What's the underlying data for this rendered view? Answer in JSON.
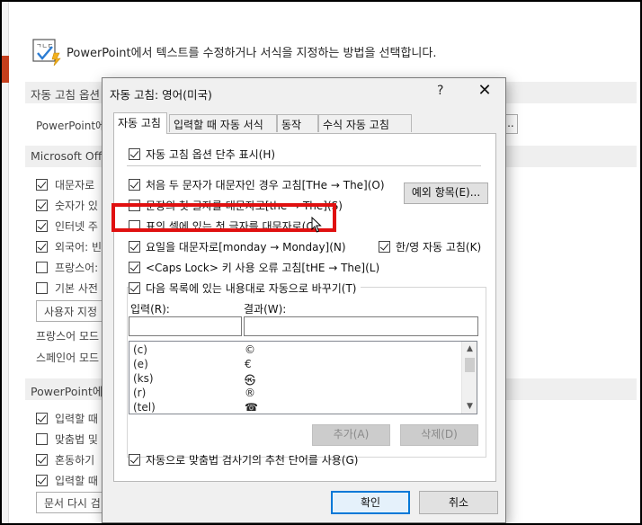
{
  "background": {
    "header_text": "PowerPoint에서 텍스트를 수정하거나 서식을 지정하는 방법을 선택합니다.",
    "header_icon": "abc-check-icon",
    "sections": [
      {
        "label": "자동 고침 옵션"
      },
      {
        "label": "Microsoft Office"
      },
      {
        "label": "PowerPoint에서"
      }
    ],
    "autocorrect_desc": "PowerPoint에",
    "office_options": [
      {
        "label": "대문자로",
        "checked": true
      },
      {
        "label": "숫자가 있",
        "checked": true
      },
      {
        "label": "인터넷 주",
        "checked": true
      },
      {
        "label": "외국어: 빈",
        "checked": true
      },
      {
        "label": "프랑스어:",
        "checked": false
      },
      {
        "label": "기본 사전",
        "checked": false
      }
    ],
    "custom_dict_button": "사용자 지정",
    "french_modes": "프랑스어 모드",
    "spanish_modes": "스페인어 모드",
    "ppt_options": [
      {
        "label": "입력할 때",
        "checked": true
      },
      {
        "label": "맞춤법 및",
        "checked": false
      },
      {
        "label": "혼동하기",
        "checked": true
      },
      {
        "label": "입력할 때",
        "checked": true
      }
    ],
    "recheck_button": "문서 다시 검",
    "dots_button": "..."
  },
  "dialog": {
    "title": "자동 고침: 영어(미국)",
    "help": "?",
    "close": "✕",
    "tabs": [
      {
        "label": "자동 고침",
        "active": true
      },
      {
        "label": "입력할 때 자동 서식",
        "active": false
      },
      {
        "label": "동작",
        "active": false
      },
      {
        "label": "수식 자동 고침",
        "active": false
      }
    ],
    "options": {
      "show_buttons": {
        "label": "자동 고침 옵션 단추 표시(H)",
        "checked": true
      },
      "two_initial_caps": {
        "label": "처음 두 문자가 대문자인 경우 고침[THe → The](O)",
        "checked": true
      },
      "first_letter_sentence": {
        "label": "문장의 첫 글자를 대문자로[the → The](S)",
        "checked": false
      },
      "first_letter_table": {
        "label": "표의 셀에 있는 첫 글자를 대문자로(C)",
        "checked": false
      },
      "day_names": {
        "label": "요일을 대문자로[monday → Monday](N)",
        "checked": true
      },
      "han_eng": {
        "label": "한/영 자동 고침(K)",
        "checked": true
      },
      "caps_lock": {
        "label": "<Caps Lock> 키 사용 오류 고침[tHE → The](L)",
        "checked": true
      },
      "replace_text": {
        "label": "다음 목록에 있는 내용대로 자동으로 바꾸기(T)",
        "checked": true
      },
      "suggest": {
        "label": "자동으로 맞춤법 검사기의 추천 단어를 사용(G)",
        "checked": true
      }
    },
    "exceptions_button": "예외 항목(E)...",
    "input_label": "입력(R):",
    "result_label": "결과(W):",
    "input_value": "",
    "result_value": "",
    "list": [
      {
        "input": "(c)",
        "result": "©"
      },
      {
        "input": "(e)",
        "result": "€"
      },
      {
        "input": "(ks)",
        "result": "㉿"
      },
      {
        "input": "(r)",
        "result": "®"
      },
      {
        "input": "(tel)",
        "result": "☎"
      }
    ],
    "add_button": "추가(A)",
    "delete_button": "삭제(D)",
    "ok_button": "확인",
    "cancel_button": "취소"
  },
  "highlight_color": "#e01010",
  "accent_color": "#0078d7"
}
